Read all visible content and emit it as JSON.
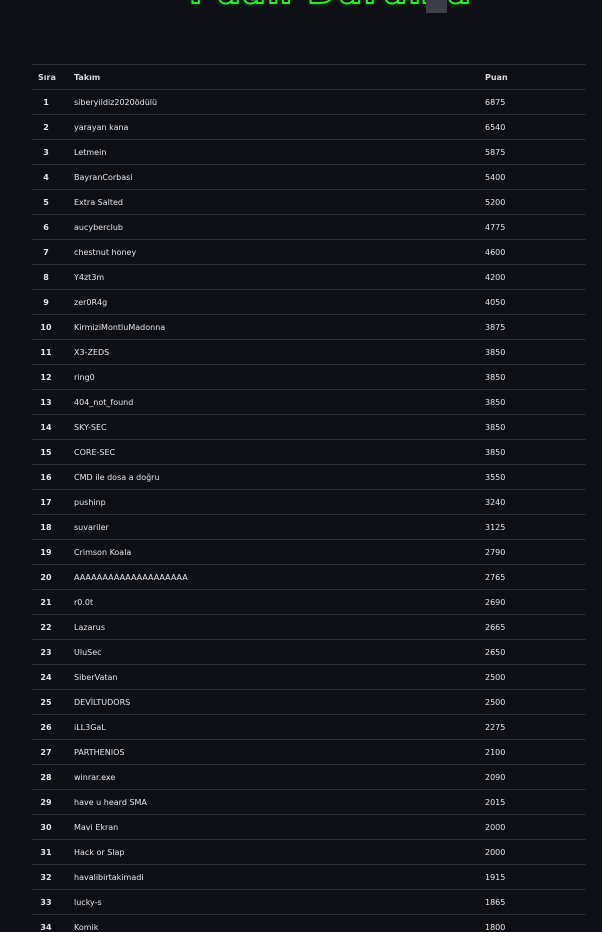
{
  "page": {
    "title": "Puan Durumu"
  },
  "table": {
    "headers": {
      "rank": "Sıra",
      "team": "Takım",
      "points": "Puan"
    },
    "rows": [
      {
        "rank": "1",
        "team": "siberyildiz2020ödülü",
        "points": "6875"
      },
      {
        "rank": "2",
        "team": "yarayan kana",
        "points": "6540"
      },
      {
        "rank": "3",
        "team": "Letmein",
        "points": "5875"
      },
      {
        "rank": "4",
        "team": "BayranCorbasi",
        "points": "5400"
      },
      {
        "rank": "5",
        "team": "Extra Salted",
        "points": "5200"
      },
      {
        "rank": "6",
        "team": "aucyberclub",
        "points": "4775"
      },
      {
        "rank": "7",
        "team": "chestnut honey",
        "points": "4600"
      },
      {
        "rank": "8",
        "team": "Y4zt3m",
        "points": "4200"
      },
      {
        "rank": "9",
        "team": "zer0R4g",
        "points": "4050"
      },
      {
        "rank": "10",
        "team": "KirmiziMontluMadonna",
        "points": "3875"
      },
      {
        "rank": "11",
        "team": "X3-ZEDS",
        "points": "3850"
      },
      {
        "rank": "12",
        "team": "ring0",
        "points": "3850"
      },
      {
        "rank": "13",
        "team": "404_not_found",
        "points": "3850"
      },
      {
        "rank": "14",
        "team": "SKY-SEC",
        "points": "3850"
      },
      {
        "rank": "15",
        "team": "CORE-SEC",
        "points": "3850"
      },
      {
        "rank": "16",
        "team": "CMD ile dosa a doğru",
        "points": "3550"
      },
      {
        "rank": "17",
        "team": "pushinp",
        "points": "3240"
      },
      {
        "rank": "18",
        "team": "suvariler",
        "points": "3125"
      },
      {
        "rank": "19",
        "team": "Crimson Koala",
        "points": "2790"
      },
      {
        "rank": "20",
        "team": "AAAAAAAAAAAAAAAAAAAA",
        "points": "2765"
      },
      {
        "rank": "21",
        "team": "r0.0t",
        "points": "2690"
      },
      {
        "rank": "22",
        "team": "Lazarus",
        "points": "2665"
      },
      {
        "rank": "23",
        "team": "UluSec",
        "points": "2650"
      },
      {
        "rank": "24",
        "team": "SiberVatan",
        "points": "2500"
      },
      {
        "rank": "25",
        "team": "DEVİLTUDORS",
        "points": "2500"
      },
      {
        "rank": "26",
        "team": "iLL3GaL",
        "points": "2275"
      },
      {
        "rank": "27",
        "team": "PARTHENIOS",
        "points": "2100"
      },
      {
        "rank": "28",
        "team": "winrar.exe",
        "points": "2090"
      },
      {
        "rank": "29",
        "team": "have u heard SMA",
        "points": "2015"
      },
      {
        "rank": "30",
        "team": "Mavi Ekran",
        "points": "2000"
      },
      {
        "rank": "31",
        "team": "Hack or Slap",
        "points": "2000"
      },
      {
        "rank": "32",
        "team": "havalibirtakimadi",
        "points": "1915"
      },
      {
        "rank": "33",
        "team": "lucky-s",
        "points": "1865"
      },
      {
        "rank": "34",
        "team": "Komik",
        "points": "1800"
      }
    ]
  },
  "colors": {
    "background": "#0e0f14",
    "title_accent": "#2ee62e",
    "row_divider": "#2a2b33"
  }
}
